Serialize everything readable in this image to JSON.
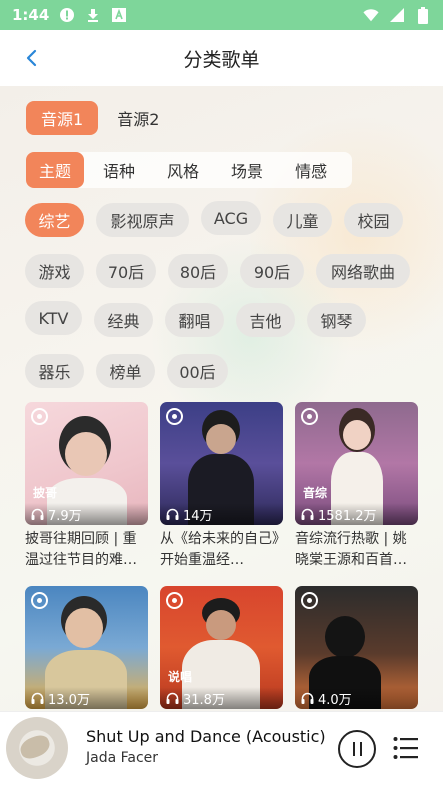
{
  "status_bar": {
    "time": "1:44",
    "icons": [
      "alert-circle-icon",
      "download-icon",
      "font-a-icon",
      "wifi-icon",
      "signal-icon",
      "battery-icon"
    ]
  },
  "header": {
    "title": "分类歌单",
    "back_icon": "chevron-left-icon"
  },
  "source_tabs": [
    {
      "label": "音源1",
      "active": true
    },
    {
      "label": "音源2",
      "active": false
    }
  ],
  "category_tabs": [
    {
      "label": "主题",
      "active": true
    },
    {
      "label": "语种",
      "active": false
    },
    {
      "label": "风格",
      "active": false
    },
    {
      "label": "场景",
      "active": false
    },
    {
      "label": "情感",
      "active": false
    }
  ],
  "chips": [
    "综艺",
    "影视原声",
    "ACG",
    "儿童",
    "校园",
    "游戏",
    "70后",
    "80后",
    "90后",
    "网络歌曲",
    "KTV",
    "经典",
    "翻唱",
    "吉他",
    "钢琴",
    "器乐",
    "榜单",
    "00后"
  ],
  "active_chip": "综艺",
  "playlists": [
    {
      "tag": "披哥",
      "plays": "7.9万",
      "title": "披哥往期回顾 | 重温过往节目的难…"
    },
    {
      "tag": "",
      "plays": "14万",
      "title": "从《给未来的自己》开始重温经…"
    },
    {
      "tag": "音综",
      "plays": "1581.2万",
      "title": "音综流行热歌 | 姚晓棠王源和百首…"
    },
    {
      "tag": "",
      "plays": "13.0万",
      "title": ""
    },
    {
      "tag": "说唱",
      "plays": "31.8万",
      "title": ""
    },
    {
      "tag": "",
      "plays": "4.0万",
      "title": ""
    }
  ],
  "player": {
    "title": "Shut Up and Dance (Acoustic)",
    "artist": "Jada Facer"
  },
  "colors": {
    "accent": "#f2855a",
    "status_bar": "#7ed69a"
  }
}
